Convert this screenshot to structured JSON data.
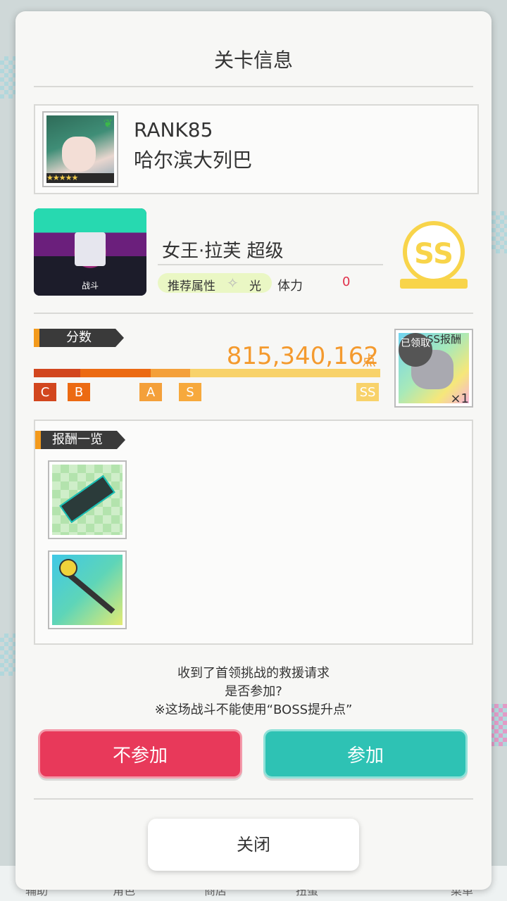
{
  "dialog": {
    "title": "关卡信息",
    "player": {
      "rank": "RANK85",
      "name": "哈尔滨大列巴",
      "stars": "★★★★★"
    },
    "stage": {
      "image_label": "战斗",
      "boss_name": "女王·拉芙 超级",
      "recommended_label": "推荐属性",
      "attribute_icon": "sparkle-icon",
      "attribute": "光",
      "stamina_label": "体力",
      "stamina_value": "0",
      "grade_badge": "SS"
    },
    "score": {
      "section_label": "分数",
      "value": "815,340,162",
      "unit": "点",
      "grades": [
        "C",
        "B",
        "A",
        "S",
        "SS"
      ],
      "colors": {
        "C": "#d2461e",
        "B": "#ec6a12",
        "A": "#f4a03a",
        "S": "#f7a93c",
        "SS": "#f8d26a"
      }
    },
    "score_reward": {
      "header": "SS报酬",
      "claimed_label": "已领取",
      "count": "×1"
    },
    "reward_list": {
      "section_label": "报酬一览",
      "items": [
        {
          "icon": "ticket-icon"
        },
        {
          "icon": "scepter-icon"
        }
      ]
    },
    "message": {
      "line1": "收到了首领挑战的救援请求",
      "line2": "是否参加?",
      "line3": "※这场战斗不能使用“BOSS提升点”"
    },
    "buttons": {
      "decline": "不参加",
      "accept": "参加",
      "close": "关闭"
    }
  },
  "background_nav": [
    "辅助",
    "角色",
    "商店",
    "扭蛋",
    "菜单"
  ],
  "colors": {
    "accent_orange": "#f49a2e",
    "decline_red": "#e8395a",
    "accept_teal": "#2ec2b4"
  }
}
